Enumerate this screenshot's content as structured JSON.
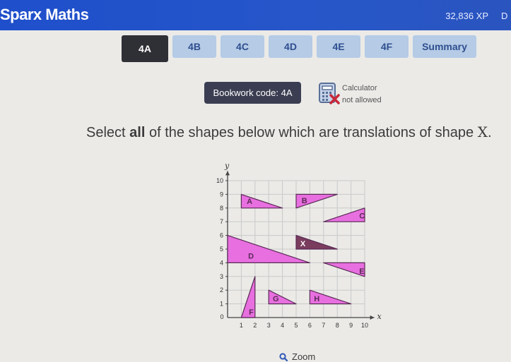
{
  "header": {
    "brand": "Sparx Maths",
    "xp": "32,836 XP",
    "user_initial": "D"
  },
  "tabs": [
    {
      "label": "4A",
      "active": true
    },
    {
      "label": "4B",
      "active": false
    },
    {
      "label": "4C",
      "active": false
    },
    {
      "label": "4D",
      "active": false
    },
    {
      "label": "4E",
      "active": false
    },
    {
      "label": "4F",
      "active": false
    },
    {
      "label": "Summary",
      "active": false
    }
  ],
  "bookwork": {
    "label": "Bookwork code: 4A"
  },
  "calculator": {
    "line1": "Calculator",
    "line2": "not allowed",
    "icon": "calculator-not-allowed-icon"
  },
  "question": {
    "prefix": "Select ",
    "bold": "all",
    "middle": " of the shapes below which are translations of shape ",
    "shape": "X",
    "suffix": "."
  },
  "graph": {
    "x_label": "x",
    "y_label": "y",
    "x_range": [
      0,
      10
    ],
    "y_range": [
      0,
      10
    ],
    "x_ticks": [
      "0",
      "1",
      "2",
      "3",
      "4",
      "5",
      "6",
      "7",
      "8",
      "9",
      "10"
    ],
    "y_ticks": [
      "1",
      "2",
      "3",
      "4",
      "5",
      "6",
      "7",
      "8",
      "9",
      "10"
    ],
    "colors": {
      "shape_fill": "#e86fe0",
      "shape_stroke": "#5a2a55",
      "target_fill": "#7a3d5e",
      "grid": "#c9c9c9",
      "axis": "#444444"
    },
    "shapes": [
      {
        "label": "A",
        "points": [
          [
            1,
            9
          ],
          [
            1,
            8
          ],
          [
            4,
            8
          ]
        ],
        "label_at": [
          1.4,
          8.5
        ],
        "target": false
      },
      {
        "label": "B",
        "points": [
          [
            5,
            8
          ],
          [
            5,
            9
          ],
          [
            8,
            9
          ]
        ],
        "label_at": [
          5.4,
          8.55
        ],
        "target": false
      },
      {
        "label": "C",
        "points": [
          [
            7,
            7
          ],
          [
            10,
            7
          ],
          [
            10,
            8
          ]
        ],
        "label_at": [
          9.6,
          7.45
        ],
        "target": false
      },
      {
        "label": "X",
        "points": [
          [
            5,
            6
          ],
          [
            5,
            5
          ],
          [
            8,
            5
          ]
        ],
        "label_at": [
          5.3,
          5.4
        ],
        "target": true
      },
      {
        "label": "D",
        "points": [
          [
            0,
            6
          ],
          [
            0,
            4
          ],
          [
            6,
            4
          ]
        ],
        "label_at": [
          1.5,
          4.5
        ],
        "target": false
      },
      {
        "label": "E",
        "points": [
          [
            7,
            4
          ],
          [
            10,
            4
          ],
          [
            10,
            3
          ]
        ],
        "label_at": [
          9.6,
          3.4
        ],
        "target": false
      },
      {
        "label": "F",
        "points": [
          [
            1,
            0
          ],
          [
            2,
            0
          ],
          [
            2,
            3
          ]
        ],
        "label_at": [
          1.55,
          0.4
        ],
        "target": false
      },
      {
        "label": "G",
        "points": [
          [
            3,
            2
          ],
          [
            3,
            1
          ],
          [
            5,
            1
          ]
        ],
        "label_at": [
          3.3,
          1.4
        ],
        "target": false
      },
      {
        "label": "H",
        "points": [
          [
            6,
            2
          ],
          [
            6,
            1
          ],
          [
            9,
            1
          ]
        ],
        "label_at": [
          6.3,
          1.4
        ],
        "target": false
      }
    ]
  },
  "zoom": {
    "label": "Zoom"
  }
}
